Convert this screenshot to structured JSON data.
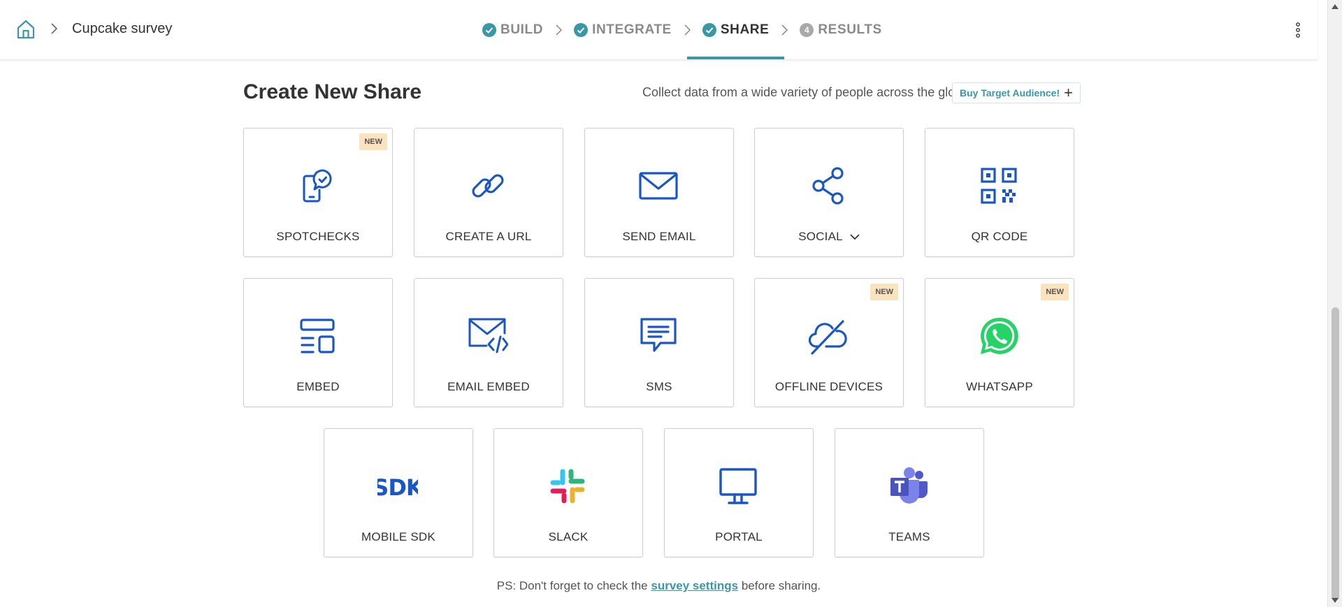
{
  "breadcrumb": {
    "survey_title": "Cupcake survey"
  },
  "steps": [
    {
      "label": "BUILD",
      "state": "done"
    },
    {
      "label": "INTEGRATE",
      "state": "done"
    },
    {
      "label": "SHARE",
      "state": "active"
    },
    {
      "label": "RESULTS",
      "state": "pending",
      "number": "4"
    }
  ],
  "header": {
    "title": "Create New Share",
    "promo_text": "Collect data from a wide variety of people across the globe",
    "buy_label": "Buy Target Audience!",
    "buy_icon": "+"
  },
  "badge_new": "NEW",
  "cards": {
    "spotchecks": {
      "label": "SPOTCHECKS",
      "icon": "phone-check-icon"
    },
    "create_url": {
      "label": "CREATE A URL",
      "icon": "link-icon"
    },
    "send_email": {
      "label": "SEND EMAIL",
      "icon": "envelope-icon"
    },
    "social": {
      "label": "SOCIAL",
      "icon": "share-icon"
    },
    "qr_code": {
      "label": "QR CODE",
      "icon": "qr-code-icon"
    },
    "embed": {
      "label": "EMBED",
      "icon": "embed-icon"
    },
    "email_embed": {
      "label": "EMAIL EMBED",
      "icon": "email-code-icon"
    },
    "sms": {
      "label": "SMS",
      "icon": "chat-bubble-icon"
    },
    "offline_devices": {
      "label": "OFFLINE DEVICES",
      "icon": "cloud-off-icon"
    },
    "whatsapp": {
      "label": "WHATSAPP",
      "icon": "whatsapp-icon"
    },
    "mobile_sdk": {
      "label": "MOBILE SDK",
      "icon": "sdk-icon"
    },
    "slack": {
      "label": "SLACK",
      "icon": "slack-icon"
    },
    "portal": {
      "label": "PORTAL",
      "icon": "monitor-icon"
    },
    "teams": {
      "label": "TEAMS",
      "icon": "teams-icon"
    }
  },
  "footer": {
    "ps_prefix": "PS: Don't forget to check the",
    "ps_link": "survey settings",
    "ps_suffix": "before sharing."
  },
  "colors": {
    "accent": "#3a97a8",
    "icon_blue": "#1a56c4",
    "new_badge_bg": "#fbe3bd",
    "whatsapp_green": "#25d366",
    "teams_purple": "#5059c9"
  }
}
